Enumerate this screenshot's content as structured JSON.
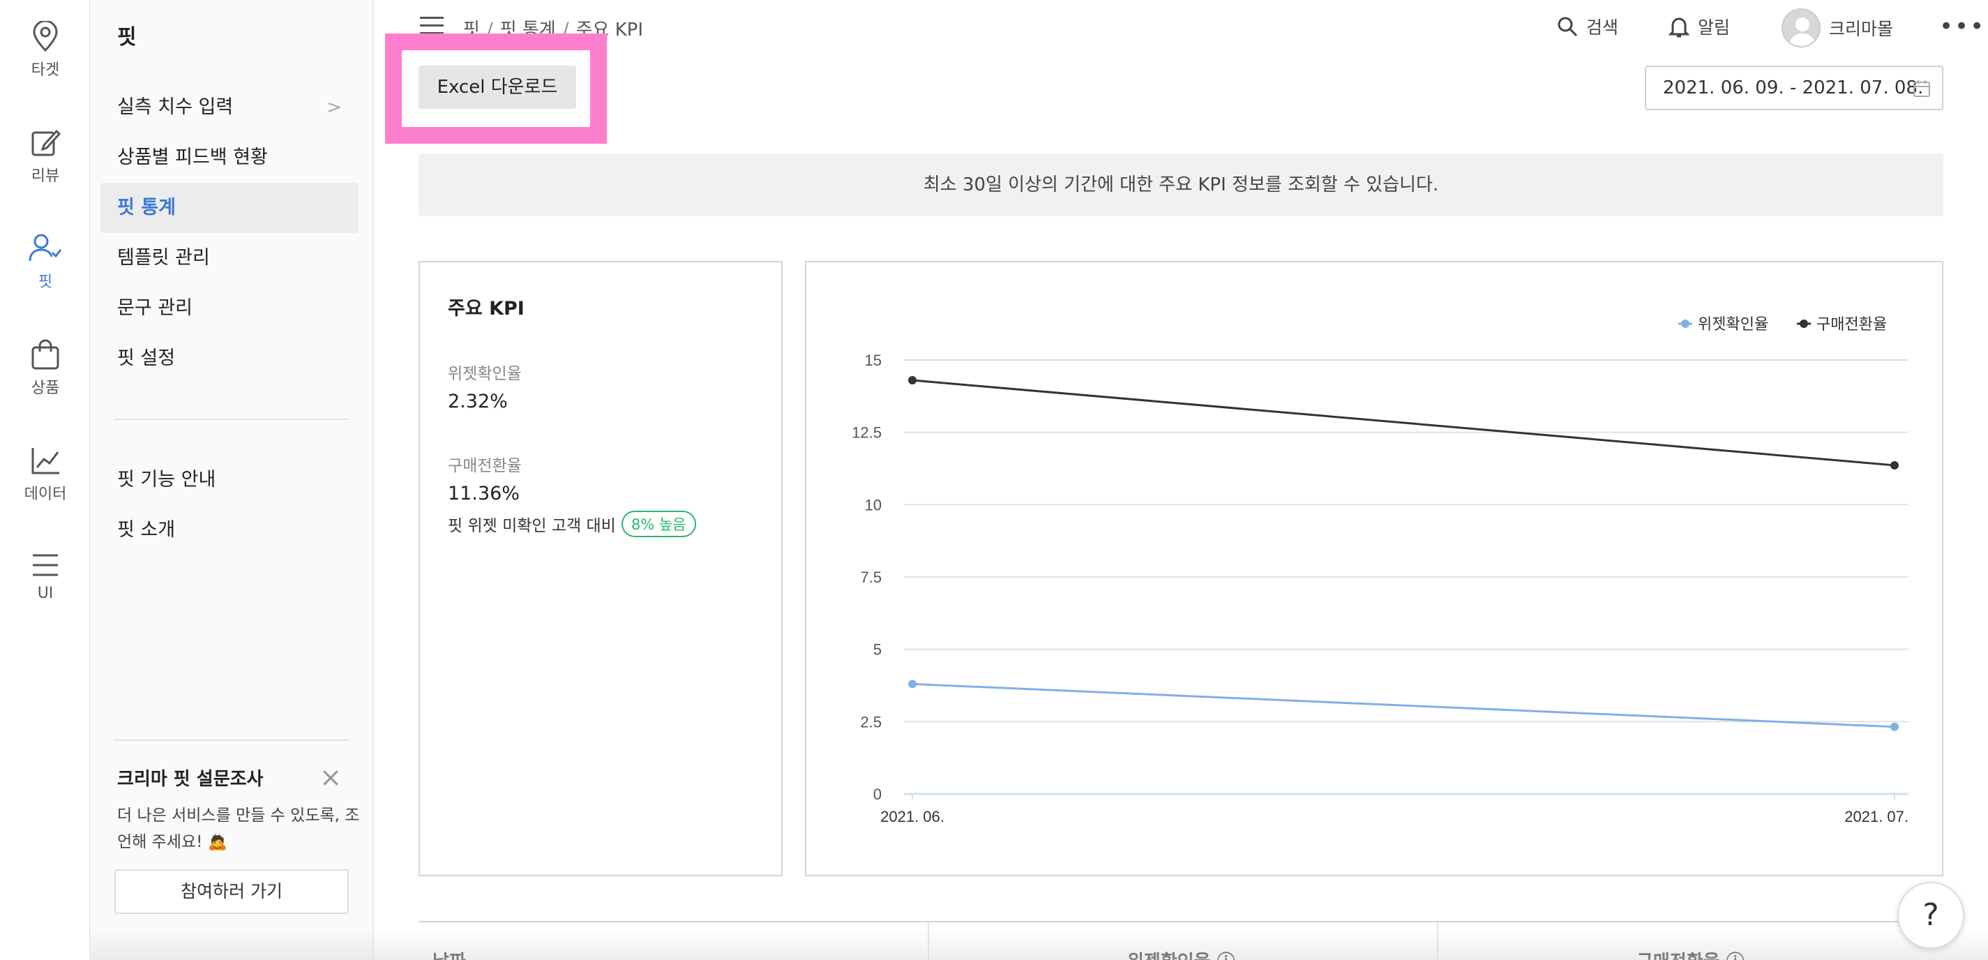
{
  "rail": {
    "items": [
      {
        "label": "타겟",
        "icon": "location-pin-icon"
      },
      {
        "label": "리뷰",
        "icon": "edit-icon"
      },
      {
        "label": "핏",
        "icon": "user-check-icon"
      },
      {
        "label": "상품",
        "icon": "shopping-bag-icon"
      },
      {
        "label": "데이터",
        "icon": "line-chart-icon"
      },
      {
        "label": "UI",
        "icon": "menu-icon"
      }
    ]
  },
  "subnav": {
    "title": "핏",
    "items": [
      {
        "label": "실측 치수 입력",
        "chevron": ">"
      },
      {
        "label": "상품별 피드백 현황"
      },
      {
        "label": "핏 통계"
      },
      {
        "label": "템플릿 관리"
      },
      {
        "label": "문구 관리"
      },
      {
        "label": "핏 설정"
      }
    ],
    "items2": [
      {
        "label": "핏 기능 안내"
      },
      {
        "label": "핏 소개"
      }
    ],
    "survey": {
      "title": "크리마 핏 설문조사",
      "close": "×",
      "text": "더 나은 서비스를 만들 수 있도록, 조언해 주세요! 🙇",
      "button": "참여하러 가기"
    }
  },
  "header": {
    "breadcrumb": [
      "핏",
      "핏 통계",
      "주요 KPI"
    ],
    "search": "검색",
    "alarm": "알림",
    "user": "크리마몰",
    "more": "•••"
  },
  "toolbar": {
    "excel": "Excel 다운로드",
    "date_range": "2021. 06. 09. - 2021. 07. 08."
  },
  "info": "최소 30일 이상의 기간에 대한 주요 KPI 정보를 조회할 수 있습니다.",
  "kpi": {
    "title": "주요 KPI",
    "widget_label": "위젯확인율",
    "widget_value": "2.32%",
    "conversion_label": "구매전환율",
    "conversion_value": "11.36%",
    "note": "핏 위젯 미확인 고객 대비",
    "badge": "8% 높음"
  },
  "chart_data": {
    "type": "line",
    "x": [
      "2021. 06.",
      "2021. 07."
    ],
    "series": [
      {
        "name": "위젯확인율",
        "values": [
          3.8,
          2.32
        ],
        "color": "#7fb0e8"
      },
      {
        "name": "구매전환율",
        "values": [
          14.3,
          11.36
        ],
        "color": "#333333"
      }
    ],
    "yticks": [
      "0",
      "2.5",
      "5",
      "7.5",
      "10",
      "12.5",
      "15"
    ],
    "ylim": [
      0,
      15
    ],
    "legend_position": "top-right",
    "grid": true
  },
  "table": {
    "headers": [
      "날짜",
      "위젯확인율 ⓘ",
      "구매전환율 ⓘ"
    ]
  },
  "help": "?"
}
